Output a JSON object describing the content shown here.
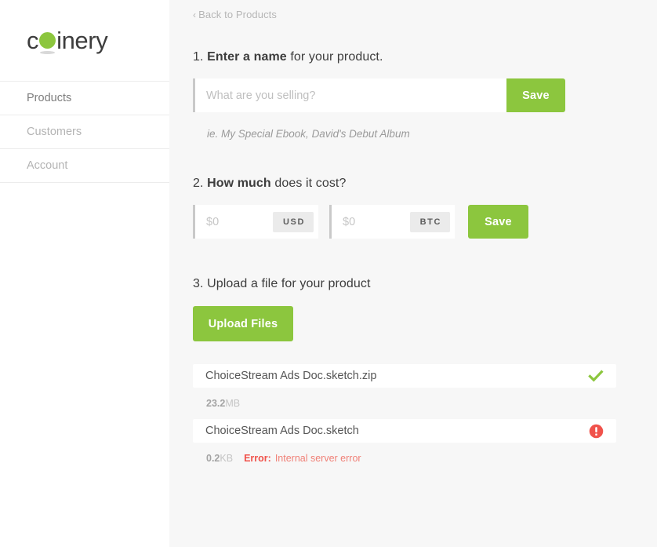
{
  "brand": {
    "name_before": "c",
    "dot_icon": "green-circle-o",
    "name_after": "inery",
    "accent_color": "#8cc63e"
  },
  "sidebar": {
    "items": [
      {
        "label": "Products",
        "active": true
      },
      {
        "label": "Customers",
        "active": false
      },
      {
        "label": "Account",
        "active": false
      }
    ]
  },
  "main": {
    "back_link": {
      "chevron": "‹",
      "label": "Back to Products"
    },
    "step1": {
      "number": "1.",
      "bold": "Enter a name",
      "rest": "for your product.",
      "input_value": "",
      "input_placeholder": "What are you selling?",
      "save_label": "Save",
      "hint": "ie. My Special Ebook, David's Debut Album"
    },
    "step2": {
      "number": "2.",
      "bold": "How much",
      "rest": "does it cost?",
      "price_usd": {
        "value": "",
        "placeholder": "$0",
        "unit": "USD"
      },
      "price_btc": {
        "value": "",
        "placeholder": "$0",
        "unit": "BTC"
      },
      "save_label": "Save"
    },
    "step3": {
      "number": "3.",
      "bold": "",
      "rest": "Upload a file for your product",
      "upload_label": "Upload Files",
      "files": [
        {
          "name": "ChoiceStream Ads Doc.sketch.zip",
          "size_num": "23.2",
          "size_unit": "MB",
          "status": "success",
          "status_icon": "green-check-icon",
          "error_label": "",
          "error_message": ""
        },
        {
          "name": "ChoiceStream Ads Doc.sketch",
          "size_num": "0.2",
          "size_unit": "KB",
          "status": "error",
          "status_icon": "red-alert-icon",
          "error_label": "Error:",
          "error_message": "Internal server error"
        }
      ]
    }
  },
  "colors": {
    "green": "#8cc63e",
    "red": "#f0524b",
    "page_bg": "#f7f7f7",
    "sidebar_bg": "#ffffff"
  }
}
